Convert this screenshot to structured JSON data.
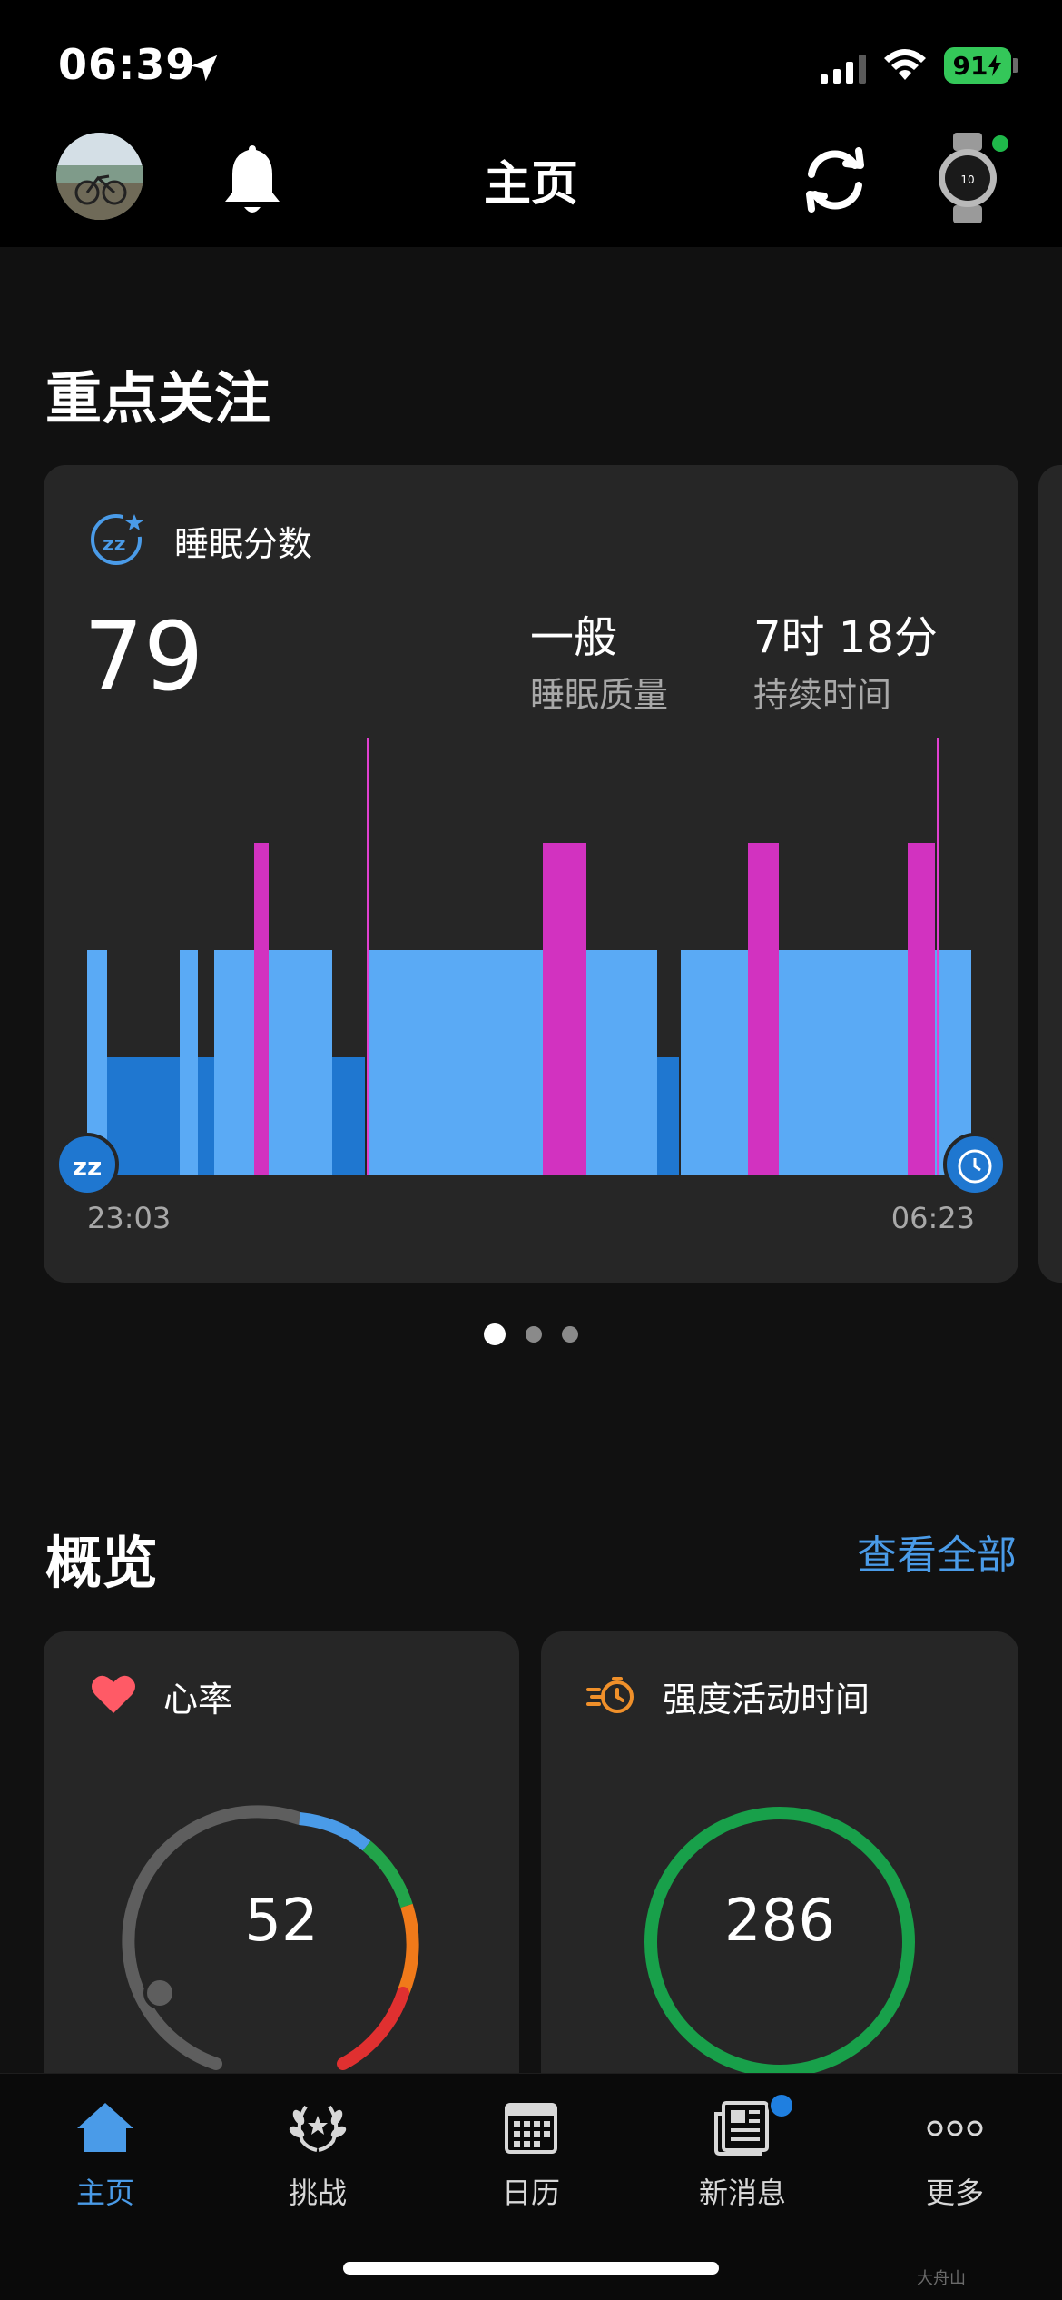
{
  "status_bar": {
    "time": "06:39",
    "battery": "91"
  },
  "header": {
    "title": "主页"
  },
  "focus": {
    "section_title": "重点关注",
    "sleep_card": {
      "label": "睡眠分数",
      "score": "79",
      "quality_value": "一般",
      "quality_label": "睡眠质量",
      "duration_value": "7时 18分",
      "duration_label": "持续时间",
      "start_time": "23:03",
      "end_time": "06:23",
      "colors": {
        "deep": "#1f77d0",
        "light": "#5aaaf5",
        "rem": "#d232c0",
        "awake": "#e040d0"
      }
    },
    "pager": {
      "count": 3,
      "active": 0
    }
  },
  "overview": {
    "section_title": "概览",
    "see_all": "查看全部",
    "heart_card": {
      "label": "心率",
      "value": "52",
      "icon": "heart-icon"
    },
    "intensity_card": {
      "label": "强度活动时间",
      "value": "286",
      "icon": "stopwatch-icon"
    }
  },
  "tabbar": {
    "items": [
      {
        "label": "主页",
        "icon": "home-icon"
      },
      {
        "label": "挑战",
        "icon": "laurel-icon"
      },
      {
        "label": "日历",
        "icon": "calendar-icon"
      },
      {
        "label": "新消息",
        "icon": "newspaper-icon"
      },
      {
        "label": "更多",
        "icon": "more-icon"
      }
    ]
  },
  "watermark": "大舟山"
}
